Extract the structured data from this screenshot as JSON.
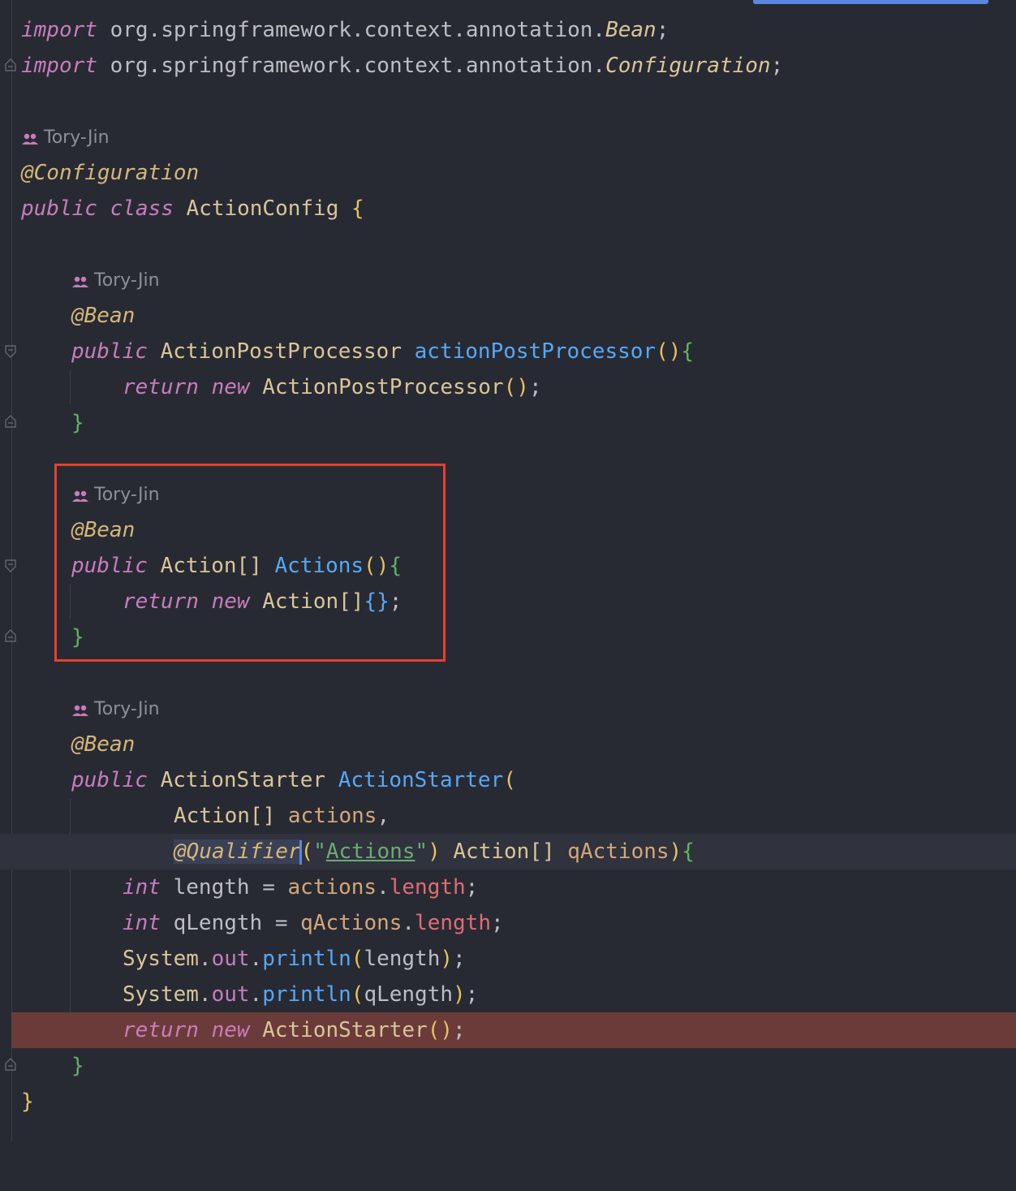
{
  "editor": {
    "imports": [
      {
        "kw": "import",
        "pkg": "org.springframework.context.annotation.",
        "cls": "Bean",
        "end": ";"
      },
      {
        "kw": "import",
        "pkg": "org.springframework.context.annotation.",
        "cls": "Configuration",
        "end": ";"
      }
    ],
    "class_block": {
      "author": "Tory-Jin",
      "annotation": "@Configuration",
      "kw_public": "public",
      "kw_class": "class",
      "name": "ActionConfig",
      "open": "{",
      "close": "}"
    },
    "method1": {
      "author": "Tory-Jin",
      "annotation": "@Bean",
      "kw_public": "public",
      "type": "ActionPostProcessor",
      "name": "actionPostProcessor",
      "parens": "()",
      "open": "{",
      "kw_return": "return",
      "kw_new": "new",
      "ctor": "ActionPostProcessor",
      "ctor_parens": "()",
      "semi": ";",
      "close": "}"
    },
    "method2": {
      "author": "Tory-Jin",
      "annotation": "@Bean",
      "kw_public": "public",
      "type": "Action[]",
      "name": "Actions",
      "parens": "()",
      "open": "{",
      "kw_return": "return",
      "kw_new": "new",
      "ctor": "Action[]",
      "init": "{}",
      "semi": ";",
      "close": "}"
    },
    "method3": {
      "author": "Tory-Jin",
      "annotation": "@Bean",
      "kw_public": "public",
      "type": "ActionStarter",
      "name": "ActionStarter",
      "open_paren": "(",
      "param1_type": "Action[]",
      "param1_name": "actions",
      "comma": ",",
      "qualifier": "@Qualifier",
      "q_open": "(",
      "q_quote_open": "\"",
      "q_value": "Actions",
      "q_quote_close": "\"",
      "q_close": ")",
      "param2_type": "Action[]",
      "param2_name": "qActions",
      "close_paren": ")",
      "open": "{",
      "kw_int": "int",
      "var_length": "length",
      "eq": "=",
      "ref_actions": "actions",
      "dot": ".",
      "fld_length": "length",
      "var_qlength": "qLength",
      "ref_qactions": "qActions",
      "system": "System",
      "out": "out",
      "println": "println",
      "kw_return": "return",
      "kw_new": "new",
      "ctor": "ActionStarter",
      "ctor_parens": "()",
      "semi": ";",
      "close": "}"
    }
  },
  "colors": {
    "background": "#282a33",
    "keyword": "#c77dbb",
    "annotation": "#d5b778",
    "function": "#56a8f5",
    "string": "#6aab73",
    "breakpoint_line": "#6b3b3a",
    "highlight_box": "#e6402e"
  },
  "icons": {
    "author": "people-icon",
    "fold": "fold-marker-icon"
  }
}
